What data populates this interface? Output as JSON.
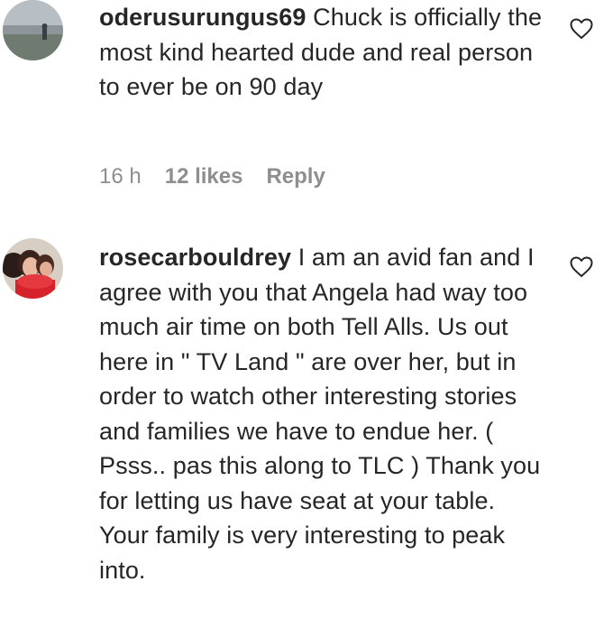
{
  "comments": [
    {
      "username": "oderusurungus69",
      "text": "Chuck is officially the most kind hearted dude and real person to ever be on 90 day",
      "time": "16 h",
      "likes": "12 likes",
      "reply": "Reply",
      "avatar_icon": "user-avatar",
      "like_icon": "heart-outline-icon"
    },
    {
      "username": "rosecarbouldrey",
      "text": "I am an avid fan and I agree with you that Angela had way too much air time on both Tell Alls. Us out here in \" TV Land \" are over her, but in order to watch other interesting stories and families we have to endue her. ( Psss.. pas this along to TLC ) Thank you for letting us have seat at your table. Your family is very interesting to peak into.",
      "avatar_icon": "user-avatar",
      "like_icon": "heart-outline-icon"
    }
  ],
  "colors": {
    "text": "#262626",
    "meta": "#8e8e8e",
    "background": "#ffffff"
  }
}
